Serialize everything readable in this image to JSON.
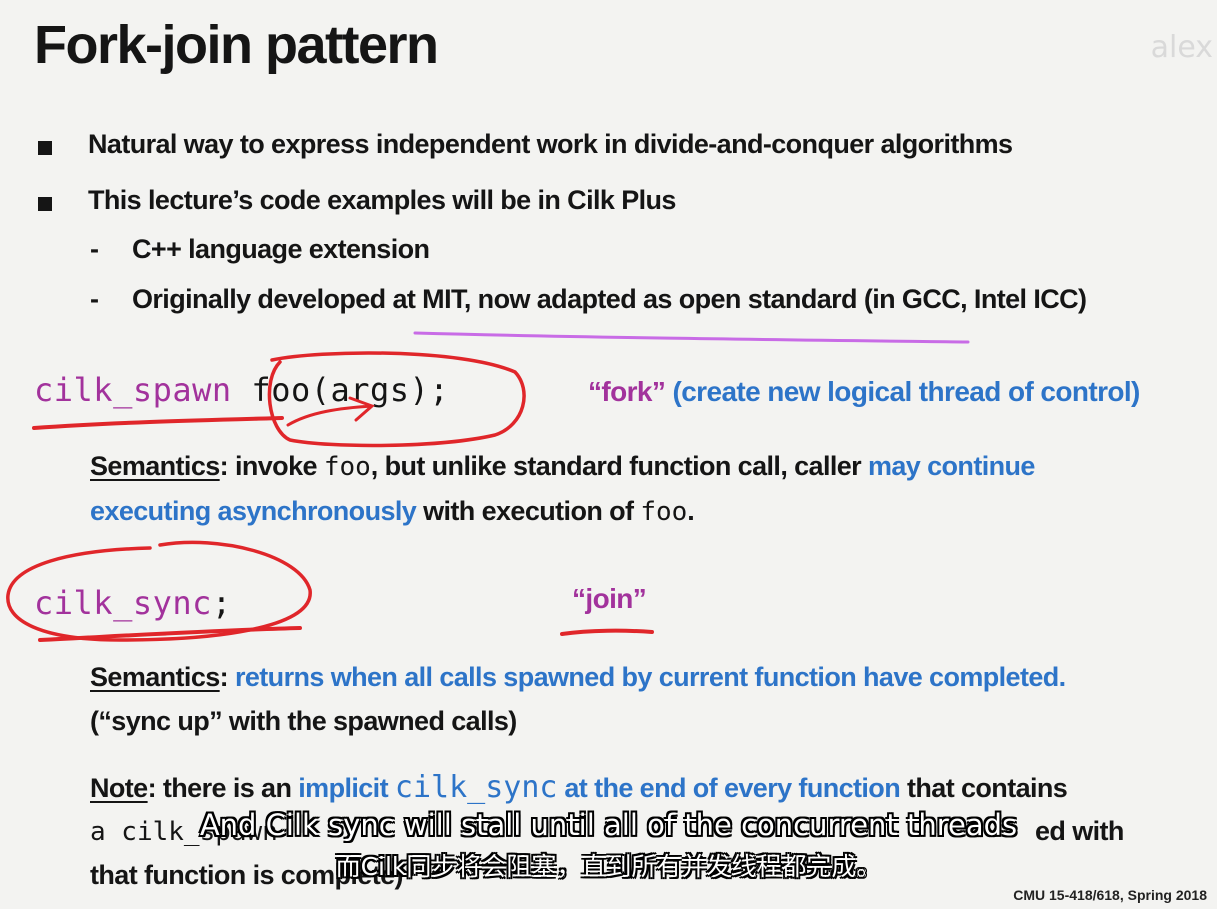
{
  "title": "Fork-join pattern",
  "watermark": "alex",
  "bullets": [
    "Natural way to express independent work in divide-and-conquer algorithms",
    "This lecture’s code examples will be in Cilk Plus"
  ],
  "sub_bullets": [
    "C++ language extension",
    "Originally developed at MIT, now adapted as open standard (in GCC, Intel ICC)"
  ],
  "spawn": {
    "keyword": "cilk_spawn",
    "call": "foo(args);",
    "label_quote": "“fork”",
    "label_desc": "(create new logical thread of control)",
    "semantics_label": "Semantics",
    "sem_p1": ": invoke ",
    "sem_code1": "foo",
    "sem_p2": ", but unlike standard function call, caller ",
    "sem_blue1": "may continue",
    "sem_blue2": "executing asynchronously",
    "sem_p3": " with execution of ",
    "sem_code2": "foo",
    "sem_p4": "."
  },
  "sync": {
    "keyword": "cilk_sync",
    "semicolon": ";",
    "label_quote": "“join”",
    "semantics_label": "Semantics",
    "sem_colon": ": ",
    "sem_blue": "returns when all calls spawned by current function have completed.",
    "sem_line2": "(“sync up” with the spawned calls)"
  },
  "note": {
    "label": "Note",
    "p1": ": there is an ",
    "blue1": "implicit ",
    "code": "cilk_sync",
    "blue2": " at the end of every function",
    "p2": " that contains",
    "line2_code": "a cilk_spawn",
    "line2_end": "ed with",
    "line3": "that function is complete)"
  },
  "subtitles": {
    "english": "And Cilk sync will stall until all of the concurrent threads",
    "chinese": "而Cilk同步将会阻塞，直到所有并发线程都完成。"
  },
  "footer": "CMU 15-418/618, Spring 2018",
  "colors": {
    "keyword_purple": "#a2329c",
    "emphasis_blue": "#2d74c8",
    "annotation_red": "#e0262a",
    "annotation_magenta": "#c86be6"
  }
}
